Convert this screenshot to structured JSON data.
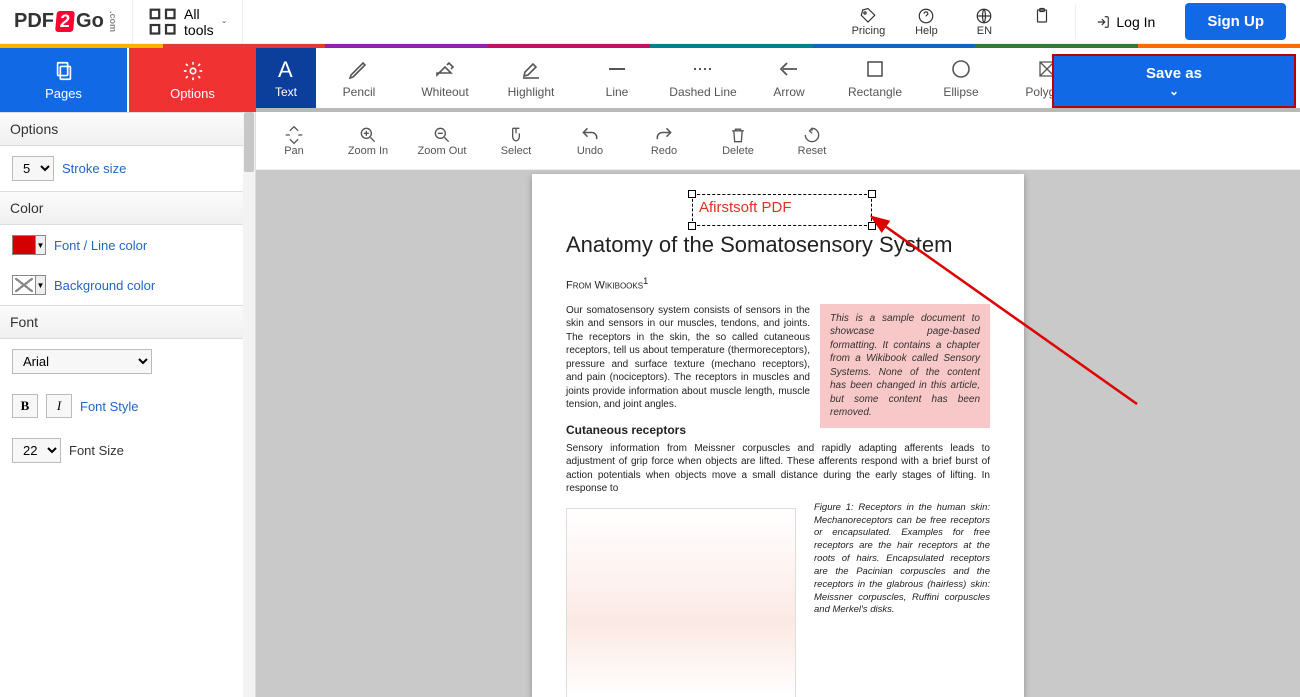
{
  "header": {
    "logo": {
      "part1": "PDF",
      "part2": "2",
      "part3": "Go",
      "suffix": ".com"
    },
    "all_tools": "All tools",
    "icons": {
      "pricing": "Pricing",
      "help": "Help",
      "lang": "EN"
    },
    "login": "Log In",
    "signup": "Sign Up"
  },
  "rainbow": [
    "#f6b400",
    "#e53935",
    "#8e24aa",
    "#c51162",
    "#00838f",
    "#1565c0",
    "#2e7d32",
    "#ff6d00"
  ],
  "big_tools": {
    "pages": "Pages",
    "options": "Options"
  },
  "tools1": [
    {
      "id": "text",
      "label": "Text",
      "active": true
    },
    {
      "id": "pencil",
      "label": "Pencil"
    },
    {
      "id": "whiteout",
      "label": "Whiteout"
    },
    {
      "id": "highlight",
      "label": "Highlight"
    },
    {
      "id": "line",
      "label": "Line"
    },
    {
      "id": "dashed",
      "label": "Dashed Line"
    },
    {
      "id": "arrow",
      "label": "Arrow"
    },
    {
      "id": "rectangle",
      "label": "Rectangle"
    },
    {
      "id": "ellipse",
      "label": "Ellipse"
    },
    {
      "id": "polygon",
      "label": "Polygon"
    }
  ],
  "saveas": "Save as",
  "tools2": [
    {
      "id": "pan",
      "label": "Pan"
    },
    {
      "id": "zoomin",
      "label": "Zoom In"
    },
    {
      "id": "zoomout",
      "label": "Zoom Out"
    },
    {
      "id": "select",
      "label": "Select"
    },
    {
      "id": "undo",
      "label": "Undo"
    },
    {
      "id": "redo",
      "label": "Redo"
    },
    {
      "id": "delete",
      "label": "Delete"
    },
    {
      "id": "reset",
      "label": "Reset"
    }
  ],
  "sidebar": {
    "options_label": "Options",
    "stroke_value": "5",
    "stroke_label": "Stroke size",
    "color_label": "Color",
    "font_line_color": "Font / Line color",
    "background_color": "Background color",
    "font_label": "Font",
    "font_family": "Arial",
    "font_style_label": "Font Style",
    "bold": "B",
    "italic": "I",
    "font_size_value": "22",
    "font_size_label": "Font Size"
  },
  "annotation_text": "Afirstsoft PDF",
  "doc": {
    "title": "Anatomy of the Somatosensory System",
    "from": "From Wikibooks",
    "superscript": "1",
    "para1": "Our somatosensory system consists of sensors in the skin and sensors in our muscles, tendons, and joints. The receptors in the skin, the so called cutaneous receptors, tell us about temperature (thermoreceptors), pressure and surface texture (mechano receptors), and pain (nociceptors). The receptors in muscles and joints provide information about muscle length, muscle tension, and joint angles.",
    "pinkbox": "This is a sample document to showcase page-based formatting. It contains a chapter from a Wikibook called Sensory Systems. None of the content has been changed in this article, but some content has been removed.",
    "h3": "Cutaneous receptors",
    "para2": "Sensory information from Meissner corpuscles and rapidly adapting afferents leads to adjustment of grip force when objects are lifted. These afferents respond with a brief burst of action potentials when objects move a small distance during the early stages of lifting. In response to",
    "figcaption": "Figure 1: Receptors in the human skin: Mechanoreceptors can be free receptors or encapsulated. Examples for free receptors are the hair receptors at the roots of hairs. Encapsulated receptors are the Pacinian corpuscles and the receptors in the glabrous (hairless) skin: Meissner corpuscles, Ruffini corpuscles and Merkel's disks."
  }
}
